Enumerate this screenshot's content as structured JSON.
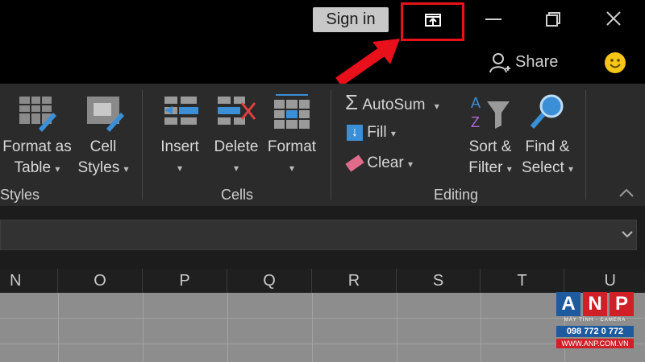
{
  "titlebar": {
    "sign_in_label": "Sign in",
    "ribbon_display_icon": "ribbon-display-options-icon",
    "minimize_icon": "minimize-icon",
    "restore_icon": "restore-icon",
    "close_icon": "close-icon"
  },
  "toprow": {
    "share_label": "Share",
    "share_icon": "person-add-icon",
    "feedback_icon": "smiley-icon"
  },
  "ribbon": {
    "styles_group": {
      "label": "Styles",
      "format_as_table": [
        "Format as",
        "Table"
      ],
      "cell_styles": [
        "Cell",
        "Styles"
      ]
    },
    "cells_group": {
      "label": "Cells",
      "insert": "Insert",
      "delete": "Delete",
      "format": "Format"
    },
    "editing_group": {
      "label": "Editing",
      "autosum": "AutoSum",
      "fill": "Fill",
      "clear": "Clear",
      "sort_filter": [
        "Sort &",
        "Filter"
      ],
      "find_select": [
        "Find &",
        "Select"
      ]
    },
    "collapse_icon": "chevron-up-icon"
  },
  "formula_bar": {
    "expand_icon": "chevron-down-icon"
  },
  "grid": {
    "columns": [
      "N",
      "O",
      "P",
      "Q",
      "R",
      "S",
      "T",
      "U"
    ]
  },
  "watermark": {
    "letters": [
      "A",
      "N",
      "P"
    ],
    "subtitle": "MÁY TÍNH - CAMERA",
    "phone": "098 772 0 772",
    "url": "WWW.ANP.COM.VN"
  },
  "colors": {
    "highlight": "#e8101a",
    "ribbon_bg": "#2b2b2b",
    "cell_bg": "#8d8d8d"
  }
}
